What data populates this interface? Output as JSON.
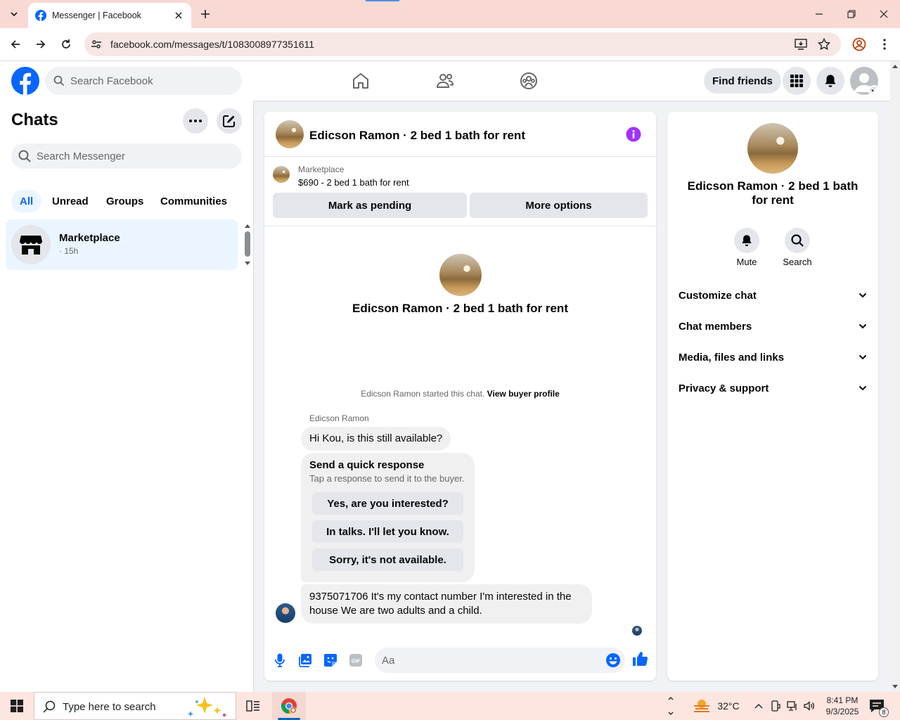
{
  "browser": {
    "tab_title": "Messenger | Facebook",
    "url": "facebook.com/messages/t/1083008977351611"
  },
  "facebook": {
    "search_placeholder": "Search Facebook",
    "find_friends": "Find friends"
  },
  "sidebar": {
    "title": "Chats",
    "search_placeholder": "Search Messenger",
    "filters": [
      "All",
      "Unread",
      "Groups",
      "Communities"
    ],
    "chat": {
      "name": "Marketplace",
      "meta": "· 15h"
    }
  },
  "chat": {
    "title": "Edicson Ramon · 2 bed 1 bath for rent",
    "listing": {
      "label": "Marketplace",
      "price_title": "$690 - 2 bed 1 bath for rent",
      "mark_pending": "Mark as pending",
      "more_options": "More options"
    },
    "intro_name": "Edicson Ramon · 2 bed 1 bath for rent",
    "started_text": "Edicson Ramon started this chat.",
    "view_buyer": "View buyer profile",
    "sender": "Edicson Ramon",
    "message1": "Hi Kou, is this still available?",
    "quick": {
      "title": "Send a quick response",
      "subtitle": "Tap a response to send it to the buyer.",
      "options": [
        "Yes, are you interested?",
        "In talks. I'll let you know.",
        "Sorry, it's not available."
      ]
    },
    "message2": "9375071706 It's my contact number I'm interested in the house We are two adults and a child.",
    "composer_placeholder": "Aa"
  },
  "info": {
    "name": "Edicson Ramon · 2 bed 1 bath for rent",
    "mute": "Mute",
    "search": "Search",
    "sections": [
      "Customize chat",
      "Chat members",
      "Media, files and links",
      "Privacy & support"
    ]
  },
  "taskbar": {
    "search_text": "Type here to search",
    "temperature": "32°C",
    "time": "8:41 PM",
    "date": "9/3/2025",
    "notifications": "8"
  },
  "colors": {
    "fb_blue": "#0866ff",
    "messenger_purple": "#a033ff",
    "selected_bg": "#ebf5ff"
  }
}
